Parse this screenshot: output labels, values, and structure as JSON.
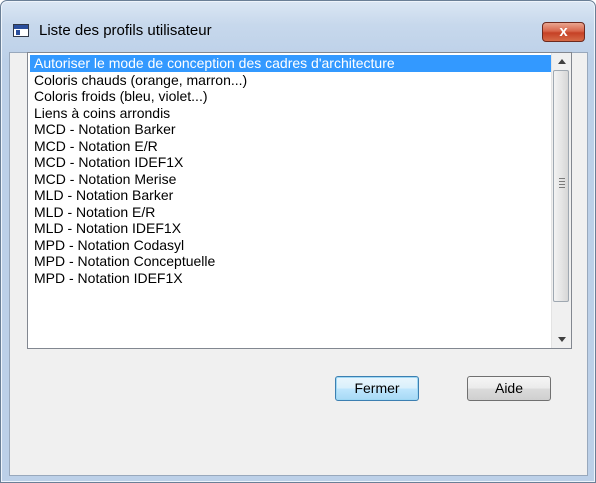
{
  "window": {
    "title": "Liste des profils utilisateur",
    "close_label": "x"
  },
  "toolbar": {
    "buttons": [
      {
        "icon": "properties-icon"
      },
      {
        "icon": "new-icon"
      },
      {
        "icon": "save-icon"
      },
      {
        "icon": "save-all-icon"
      },
      {
        "icon": "open-folder-icon"
      },
      {
        "icon": "import-icon"
      },
      {
        "icon": "export-icon"
      },
      {
        "icon": "apply-icon"
      },
      {
        "icon": "update-icon"
      },
      {
        "icon": "compare-icon"
      },
      {
        "icon": "repository-icon"
      }
    ]
  },
  "list": {
    "selected_index": 0,
    "items": [
      "Autoriser le mode de conception des cadres d'architecture",
      "Coloris chauds (orange, marron...)",
      "Coloris froids (bleu, violet...)",
      "Liens à coins arrondis",
      "MCD - Notation Barker",
      "MCD - Notation E/R",
      "MCD - Notation IDEF1X",
      "MCD - Notation Merise",
      "MLD - Notation Barker",
      "MLD - Notation E/R",
      "MLD - Notation IDEF1X",
      "MPD - Notation Codasyl",
      "MPD - Notation Conceptuelle",
      "MPD - Notation IDEF1X"
    ]
  },
  "buttons": {
    "close_label": "Fermer",
    "help_label": "Aide"
  },
  "colors": {
    "selection": "#3399ff",
    "close_button": "#c64126"
  }
}
